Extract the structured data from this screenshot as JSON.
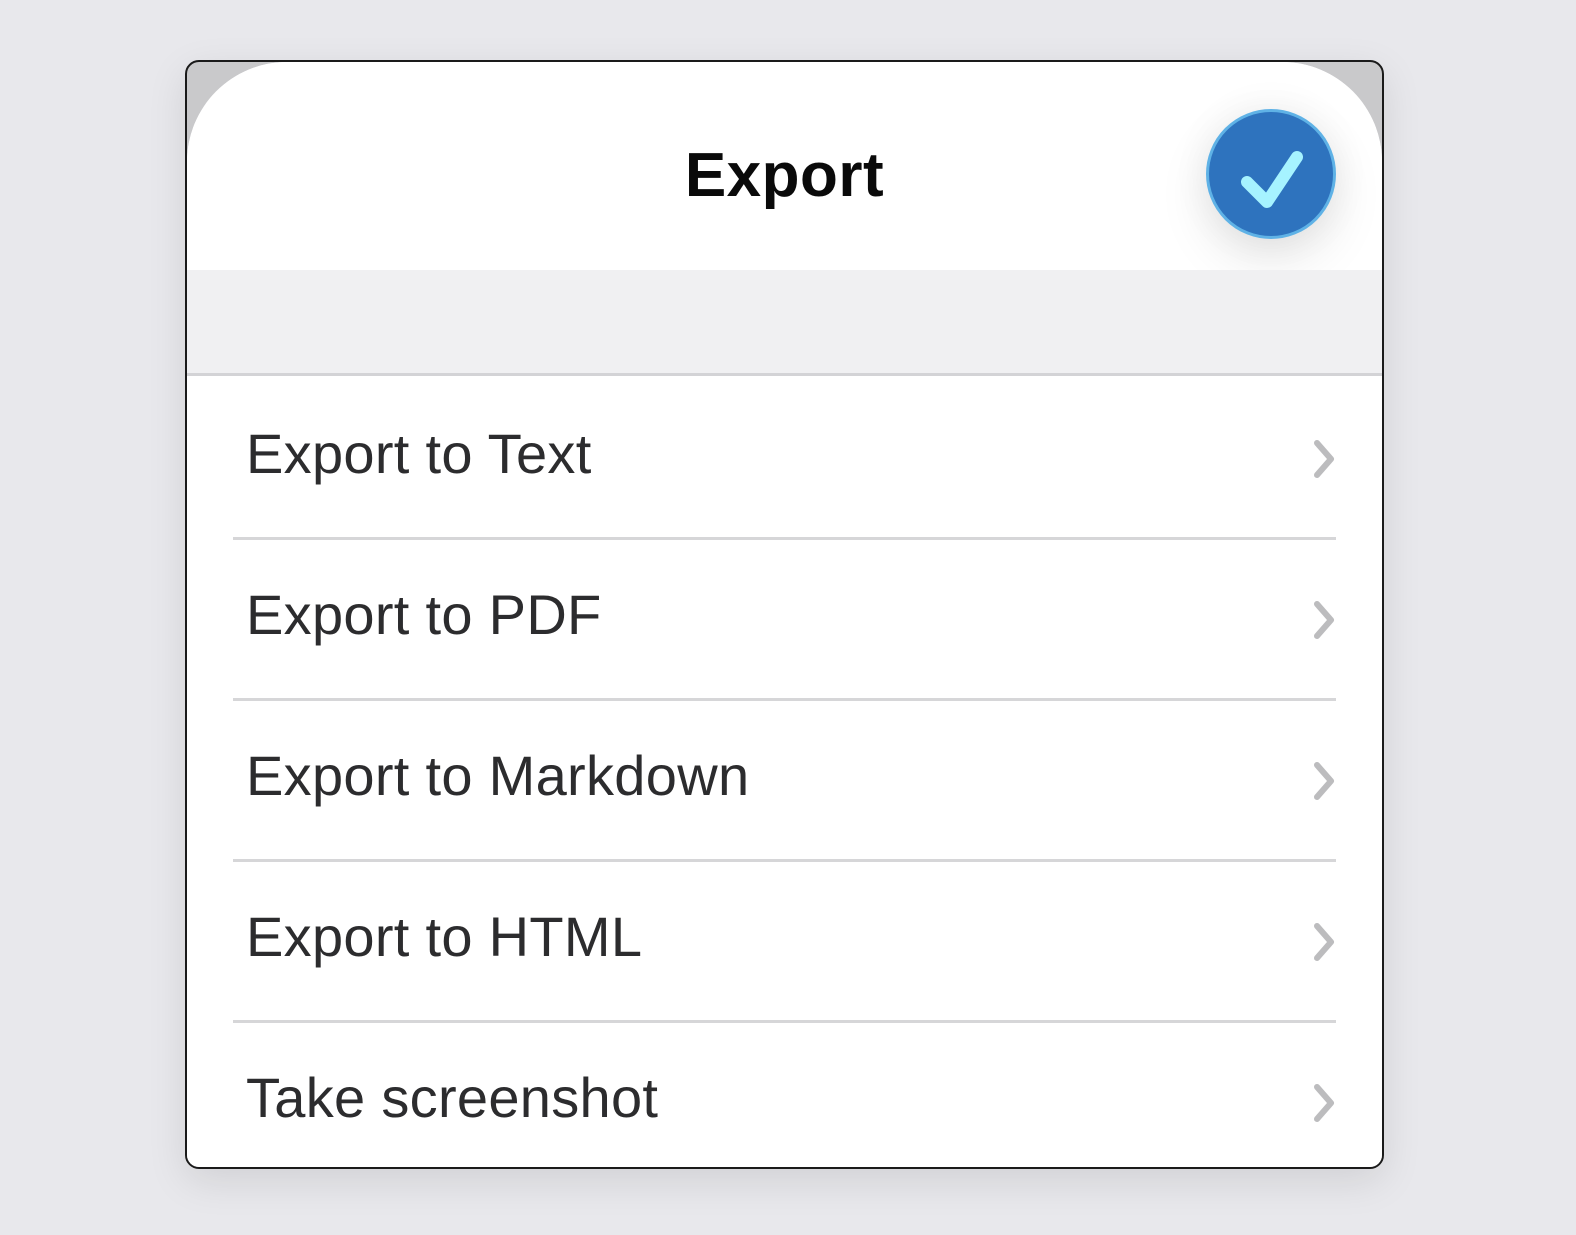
{
  "header": {
    "title": "Export",
    "done_icon": "checkmark-icon"
  },
  "colors": {
    "accent": "#2e73be",
    "check": "#a6f3ff",
    "chevron": "#bcbcbe"
  },
  "menu": {
    "items": [
      {
        "label": "Export to Text",
        "icon": "chevron-right-icon"
      },
      {
        "label": "Export to PDF",
        "icon": "chevron-right-icon"
      },
      {
        "label": "Export to Markdown",
        "icon": "chevron-right-icon"
      },
      {
        "label": "Export to HTML",
        "icon": "chevron-right-icon"
      },
      {
        "label": "Take screenshot",
        "icon": "chevron-right-icon"
      }
    ]
  }
}
